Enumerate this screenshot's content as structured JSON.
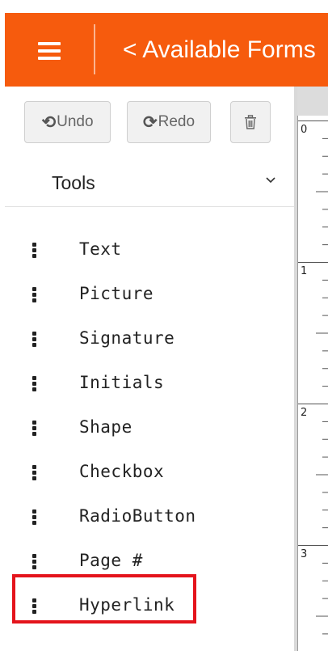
{
  "header": {
    "background_color": "#f65b0d",
    "back_label": "< Available Forms"
  },
  "toolbar": {
    "undo_label": "Undo",
    "redo_label": "Redo",
    "undo_icon": "undo-icon",
    "redo_icon": "redo-icon",
    "delete_icon": "trash-icon"
  },
  "tools": {
    "title": "Tools",
    "expanded": true,
    "items": [
      {
        "label": "Text"
      },
      {
        "label": "Picture"
      },
      {
        "label": "Signature"
      },
      {
        "label": "Initials"
      },
      {
        "label": "Shape"
      },
      {
        "label": "Checkbox"
      },
      {
        "label": "RadioButton"
      },
      {
        "label": "Page #"
      },
      {
        "label": "Hyperlink",
        "highlighted": true
      }
    ]
  },
  "ruler": {
    "labels": [
      "0",
      "1",
      "2",
      "3"
    ]
  },
  "colors": {
    "highlight": "#e4141c",
    "text": "#222222"
  }
}
